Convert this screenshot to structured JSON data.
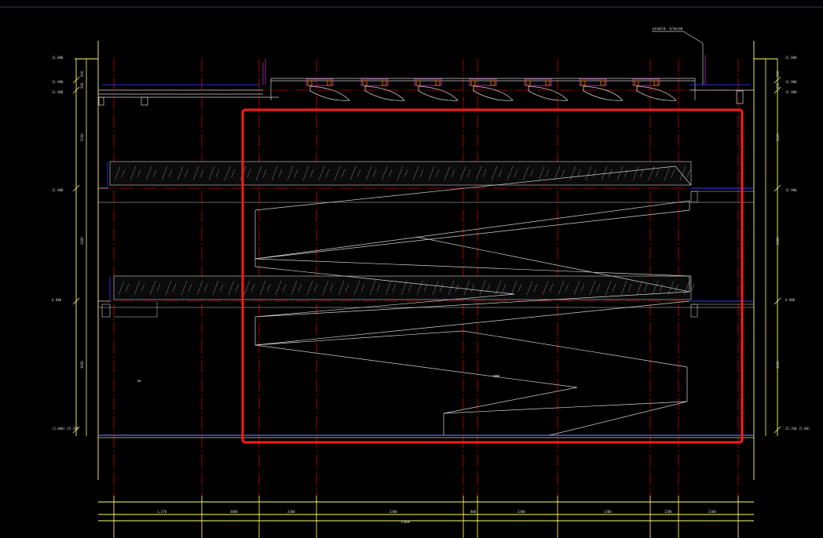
{
  "drawing": {
    "top_callout": "ভdimbl0. 0/4m/m0",
    "center_note": "ⅢⅢⅢ",
    "left_note": "Ⅱⅲ"
  },
  "levels_left": [
    "11.800",
    "11.900",
    "11.900",
    "11.900",
    "6.900",
    "(3.000) 25.350"
  ],
  "levels_right": [
    "11.800",
    "11.900",
    "11.900",
    "11.900",
    "6.900",
    "25.350 (5.00)"
  ],
  "dims_left": [
    "500",
    "500",
    "5100",
    "3300",
    "3600"
  ],
  "dims_right": [
    "500",
    "500",
    "5100",
    "3300",
    "3600"
  ],
  "bottom_dims": [
    "1,270",
    "2000",
    "2300",
    "2300",
    "800",
    "2300",
    "2300",
    "1200",
    "2300",
    "12000"
  ],
  "colors": {
    "background": "#000000",
    "frame": "#ffff66",
    "axis": "#cc0000",
    "slab": "#d0d0d0",
    "highlight": "#ff1a1a",
    "accent_blue": "#3344ff",
    "accent_magenta": "#cc33cc",
    "accent_orange": "#ff8800"
  }
}
